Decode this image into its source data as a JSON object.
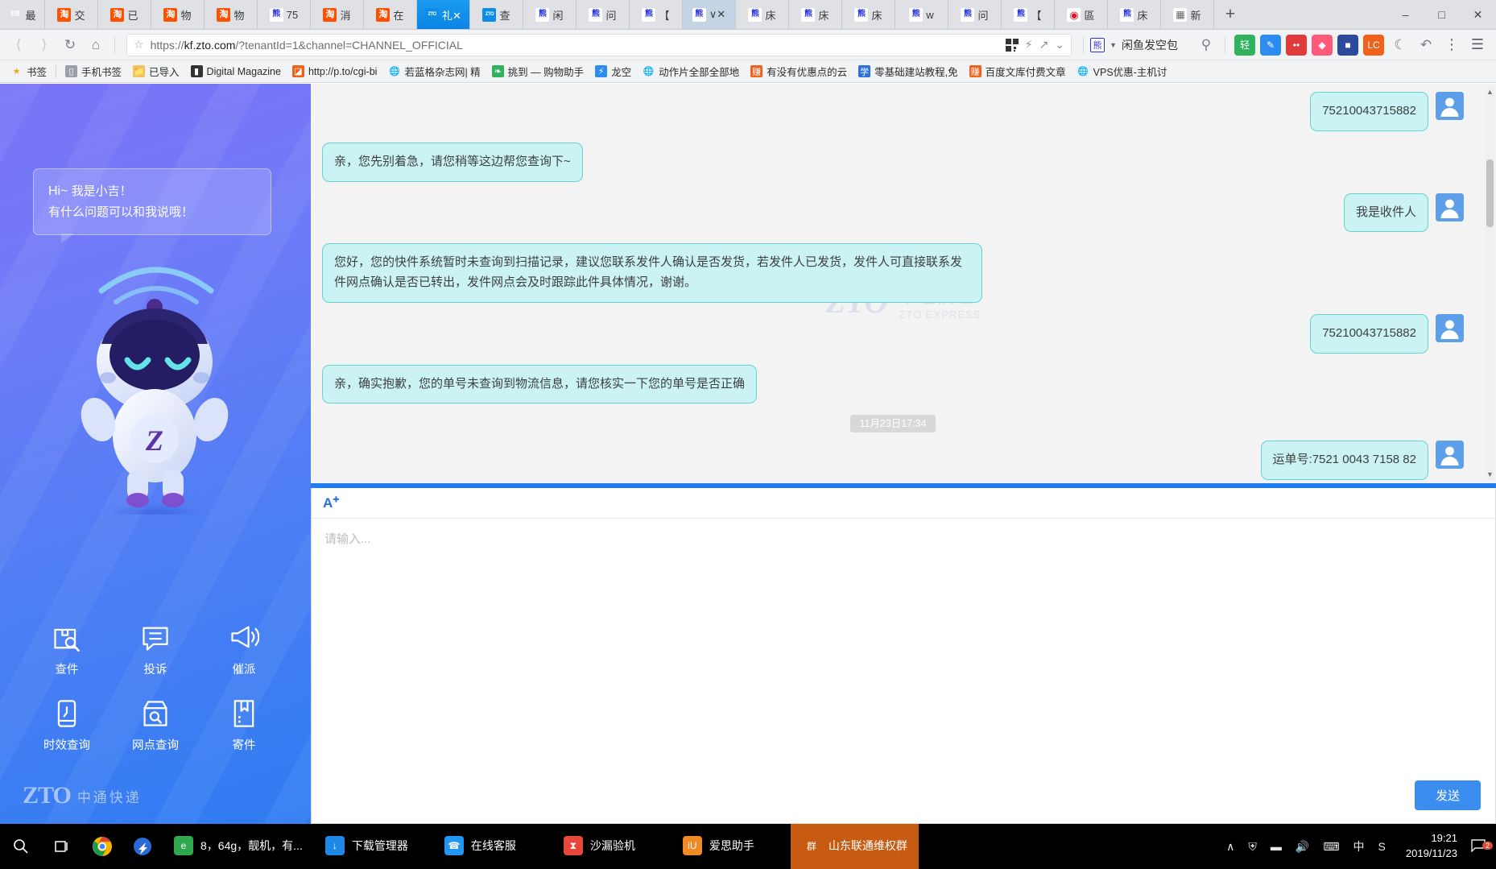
{
  "browser": {
    "tabs": [
      {
        "icon": "number-08-icon",
        "label": "最",
        "state": "normal"
      },
      {
        "icon": "taobao-icon",
        "label": "交",
        "state": "normal"
      },
      {
        "icon": "taobao-icon",
        "label": "已",
        "state": "normal"
      },
      {
        "icon": "taobao-icon",
        "label": "物",
        "state": "normal"
      },
      {
        "icon": "taobao-icon",
        "label": "物",
        "state": "normal"
      },
      {
        "icon": "baidu-icon",
        "label": "75",
        "state": "normal"
      },
      {
        "icon": "taobao-icon",
        "label": "消",
        "state": "normal"
      },
      {
        "icon": "taobao-icon",
        "label": "在",
        "state": "normal"
      },
      {
        "icon": "zto-icon",
        "label": "礼✕",
        "state": "active"
      },
      {
        "icon": "zto-icon",
        "label": "查",
        "state": "normal"
      },
      {
        "icon": "baidu-icon",
        "label": "闲",
        "state": "normal"
      },
      {
        "icon": "baidu-icon",
        "label": "问",
        "state": "normal"
      },
      {
        "icon": "baidu-icon",
        "label": "【",
        "state": "normal"
      },
      {
        "icon": "baidu-icon",
        "label": "∨✕",
        "state": "semi"
      },
      {
        "icon": "baidu-icon",
        "label": "床",
        "state": "normal"
      },
      {
        "icon": "baidu-icon",
        "label": "床",
        "state": "normal"
      },
      {
        "icon": "baidu-icon",
        "label": "床",
        "state": "normal"
      },
      {
        "icon": "baidu-icon",
        "label": "w",
        "state": "normal"
      },
      {
        "icon": "baidu-icon",
        "label": "问",
        "state": "normal"
      },
      {
        "icon": "baidu-icon",
        "label": "【",
        "state": "normal"
      },
      {
        "icon": "weibo-icon",
        "label": "區",
        "state": "normal"
      },
      {
        "icon": "baidu-icon",
        "label": "床",
        "state": "normal"
      },
      {
        "icon": "grid-icon",
        "label": "新",
        "state": "normal"
      }
    ],
    "new_tab_label": "+",
    "window_minimize": "–",
    "window_maximize": "□",
    "window_close": "✕",
    "url_protocol": "https://",
    "url_host": "kf.zto.com",
    "url_path": "/?tenantId=1&channel=CHANNEL_OFFICIAL",
    "profile_name": "闲鱼发空包",
    "back_icon": "back-arrow-icon",
    "forward_icon": "forward-arrow-icon",
    "reload_icon": "reload-icon",
    "home_icon": "home-icon",
    "bookmark_star_icon": "star-icon",
    "qr_icon": "qrcode-icon",
    "lightning_icon": "lightning-icon",
    "share_icon": "share-icon",
    "chevron_icon": "chevron-down-icon",
    "search_icon": "search-icon",
    "menu_icon": "hamburger-menu-icon",
    "moon_icon": "moon-icon",
    "undo_icon": "undo-icon",
    "more_icon": "more-vertical-icon",
    "extensions": [
      {
        "name": "qing-extension",
        "label": "轻",
        "color": "#2fb25c"
      },
      {
        "name": "blue-pen-extension",
        "label": "✎",
        "color": "#2d8cf0"
      },
      {
        "name": "red-dots-extension",
        "label": "••",
        "color": "#e03b3b"
      },
      {
        "name": "pink-extension",
        "label": "◆",
        "color": "#ff5a7a"
      },
      {
        "name": "navy-extension",
        "label": "■",
        "color": "#2b4a9b"
      },
      {
        "name": "lc-extension",
        "label": "LC",
        "color": "#f0611a"
      }
    ],
    "bookmarks": [
      {
        "label": "书签",
        "icon": "star-icon",
        "color": "#f5a623"
      },
      {
        "label": "手机书签",
        "icon": "phone-icon",
        "color": "#9aa0a6"
      },
      {
        "label": "已导入",
        "icon": "folder-icon",
        "color": "#f2c25c"
      },
      {
        "label": "Digital Magazine",
        "icon": "magazine-icon",
        "color": "#333333"
      },
      {
        "label": "http://p.to/cgi-bi",
        "icon": "page-icon",
        "color": "#f0611a"
      },
      {
        "label": "若蓝格杂志网| 精",
        "icon": "globe-icon",
        "color": "#777777"
      },
      {
        "label": "挑到 — 购物助手",
        "icon": "leaf-icon",
        "color": "#2fb25c"
      },
      {
        "label": "龙空",
        "icon": "dragon-icon",
        "color": "#2d8cf0"
      },
      {
        "label": "动作片全部全部地",
        "icon": "globe-icon",
        "color": "#777777"
      },
      {
        "label": "有没有优惠点的云",
        "icon": "coupon-icon",
        "color": "#f0611a"
      },
      {
        "label": "零基础建站教程,免",
        "icon": "blue-icon",
        "color": "#2d6fd8"
      },
      {
        "label": "百度文库付费文章",
        "icon": "coupon-icon",
        "color": "#f0611a"
      },
      {
        "label": "VPS优惠-主机讨",
        "icon": "globe-icon",
        "color": "#777777"
      }
    ]
  },
  "sidebar": {
    "greeting_line1_bold": "Hi~",
    "greeting_line1_rest": " 我是小吉！",
    "greeting_line2": "有什么问题可以和我说哦！",
    "quick_actions": [
      {
        "label": "查件",
        "icon": "package-search-icon"
      },
      {
        "label": "投诉",
        "icon": "chat-complaint-icon"
      },
      {
        "label": "催派",
        "icon": "megaphone-icon"
      },
      {
        "label": "时效查询",
        "icon": "clock-phone-icon"
      },
      {
        "label": "网点查询",
        "icon": "store-search-icon"
      },
      {
        "label": "寄件",
        "icon": "box-send-icon"
      }
    ],
    "logo_mark": "ZTO",
    "logo_cn": "中通快递",
    "robot_name": "zto-robot-mascot"
  },
  "chat": {
    "watermark_mark": "ZTO",
    "watermark_cn": "中通快递",
    "watermark_en": "ZTO EXPRESS",
    "messages": [
      {
        "side": "right",
        "text": "75210043715882",
        "type": "text"
      },
      {
        "side": "left",
        "text": "亲，您先别着急，请您稍等这边帮您查询下~",
        "type": "text"
      },
      {
        "side": "right",
        "text": "我是收件人",
        "type": "text"
      },
      {
        "side": "left",
        "text": "您好，您的快件系统暂时未查询到扫描记录，建议您联系发件人确认是否发货，若发件人已发货，发件人可直接联系发件网点确认是否已转出，发件网点会及时跟踪此件具体情况，谢谢。",
        "type": "text"
      },
      {
        "side": "right",
        "text": "75210043715882",
        "type": "text"
      },
      {
        "side": "left",
        "text": "亲，确实抱歉，您的单号未查询到物流信息，请您核实一下您的单号是否正确",
        "type": "text"
      },
      {
        "side": "center",
        "text": "11月23日17:34",
        "type": "timestamp"
      },
      {
        "side": "right",
        "text": "运单号:7521 0043 7158 82",
        "type": "text"
      }
    ],
    "scroll_up_arrow": "▲",
    "scroll_down_arrow": "▼"
  },
  "composer": {
    "format_icon_label": "A",
    "placeholder": "请输入...",
    "value": "",
    "send_label": "发送"
  },
  "taskbar": {
    "start_icon": "search-icon",
    "taskview_icon": "task-view-icon",
    "pinned": [
      {
        "name": "chrome-icon",
        "label": "Chrome"
      },
      {
        "name": "thunder-icon",
        "label": "Thunder"
      }
    ],
    "tasks": [
      {
        "label": "8，64g，靓机，有...",
        "icon": "edge-icon",
        "color": "#2fa84f",
        "active": false
      },
      {
        "label": "下载管理器",
        "icon": "download-manager-icon",
        "color": "#1e88e5",
        "active": false
      },
      {
        "label": "在线客服",
        "icon": "online-service-icon",
        "color": "#2196f3",
        "active": false
      },
      {
        "label": "沙漏验机",
        "icon": "hourglass-icon",
        "color": "#e8483c",
        "active": false
      },
      {
        "label": "爱思助手",
        "icon": "aisi-icon",
        "color": "#f08a24",
        "active": false
      },
      {
        "label": "山东联通维权群",
        "icon": "qq-group-icon",
        "color": "#c75b12",
        "active": true
      }
    ],
    "tray": [
      {
        "name": "chevron-up-icon",
        "glyph": "∧"
      },
      {
        "name": "shield-icon",
        "glyph": "⛨"
      },
      {
        "name": "battery-icon",
        "glyph": "▬"
      },
      {
        "name": "volume-icon",
        "glyph": "🔊"
      },
      {
        "name": "keyboard-icon",
        "glyph": "⌨"
      },
      {
        "name": "ime-chinese-icon",
        "glyph": "中"
      },
      {
        "name": "sogou-icon",
        "glyph": "S"
      }
    ],
    "clock_time": "19:21",
    "clock_date": "2019/11/23",
    "notification_count": "2",
    "notification_icon": "notification-icon"
  }
}
